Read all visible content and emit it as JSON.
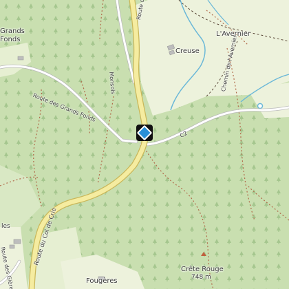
{
  "map": {
    "labels": {
      "grands_fonds_topleft_1": "Grands",
      "grands_fonds_topleft_2": "Fonds",
      "l_avernier": "L'Avernier",
      "creuse": "Creuse",
      "route_du_top": "Route du",
      "chemin_avernier": "Chemin de l'Avernier",
      "monsols": "Monsols",
      "route_grands_fonds": "Route des Grands Fonds",
      "c2": "C2",
      "route_col_crie": "Route du Col de Crie",
      "route_des_gleres": "Route des Glères",
      "les_left": "les",
      "fougeres": "Fougères",
      "crete_rouge": "Crête Rouge",
      "crete_rouge_elev": "748 m"
    },
    "colors": {
      "forest": "#c9dfb0",
      "meadow": "#edf2dc",
      "major_road": "#f5eca0",
      "road_casing": "#c9b75a",
      "minor_road": "#ffffff",
      "trail": "#b06a4a",
      "water": "#6bb8d8",
      "marker": "#2a8fd6"
    },
    "marker_icon": "directions-diamond-icon"
  }
}
